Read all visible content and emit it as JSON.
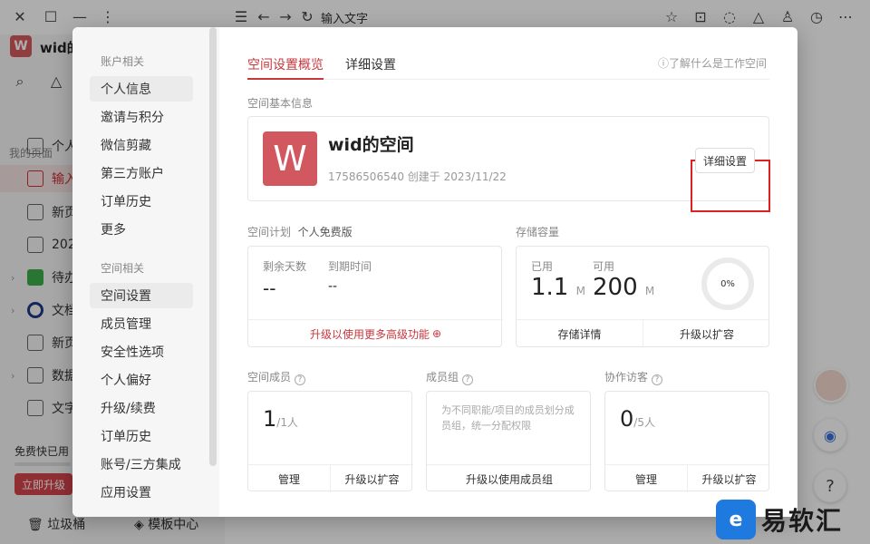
{
  "background": {
    "doc_title": "输入文字",
    "workspace_logo_letter": "W",
    "workspace_name": "wid的",
    "sidebar_label": "我的页面",
    "sidebar_items": [
      {
        "label": "个人",
        "icon": "bookmark-icon"
      },
      {
        "label": "输入",
        "icon": "doc-icon",
        "active": true
      },
      {
        "label": "新页",
        "icon": "page-icon"
      },
      {
        "label": "202",
        "icon": "page-icon"
      },
      {
        "label": "待办",
        "icon": "check-icon"
      },
      {
        "label": "文档",
        "icon": "target-icon"
      },
      {
        "label": "新页",
        "icon": "doc-icon"
      },
      {
        "label": "数据",
        "icon": "table-icon"
      },
      {
        "label": "文字",
        "icon": "doc-icon"
      }
    ],
    "free_text": "免费快已用",
    "upgrade_label": "立即升级",
    "trash_label": "垃圾桶",
    "template_label": "模板中心"
  },
  "nav": {
    "account_group": "账户相关",
    "account_items": [
      "个人信息",
      "邀请与积分",
      "微信剪藏",
      "第三方账户",
      "订单历史",
      "更多"
    ],
    "space_group": "空间相关",
    "space_items": [
      "空间设置",
      "成员管理",
      "安全性选项",
      "个人偏好",
      "升级/续费",
      "订单历史",
      "账号/三方集成",
      "应用设置"
    ]
  },
  "tabs": {
    "overview": "空间设置概览",
    "detail": "详细设置",
    "help": "了解什么是工作空间"
  },
  "basic": {
    "label": "空间基本信息",
    "logo_letter": "W",
    "name": "wid的空间",
    "meta": "17586506540 创建于 2023/11/22",
    "detail_button": "详细设置"
  },
  "plan": {
    "label": "空间计划",
    "plan_name": "个人免费版",
    "remaining_label": "剩余天数",
    "remaining_value": "--",
    "expire_label": "到期时间",
    "expire_value": "--",
    "upgrade_label": "升级以使用更多高级功能"
  },
  "storage": {
    "label": "存储容量",
    "used_label": "已用",
    "used_value": "1.1",
    "used_unit": "M",
    "available_label": "可用",
    "available_value": "200",
    "available_unit": "M",
    "percent": "0%",
    "details_button": "存储详情",
    "expand_button": "升级以扩容"
  },
  "members": {
    "label": "空间成员",
    "count": "1",
    "limit": "/1人",
    "manage": "管理",
    "expand": "升级以扩容"
  },
  "groups": {
    "label": "成员组",
    "description": "为不同职能/项目的成员划分成员组，统一分配权限",
    "button": "升级以使用成员组"
  },
  "guests": {
    "label": "协作访客",
    "count": "0",
    "limit": "/5人",
    "manage": "管理",
    "expand": "升级以扩容"
  },
  "watermark": {
    "text": "易软汇"
  }
}
